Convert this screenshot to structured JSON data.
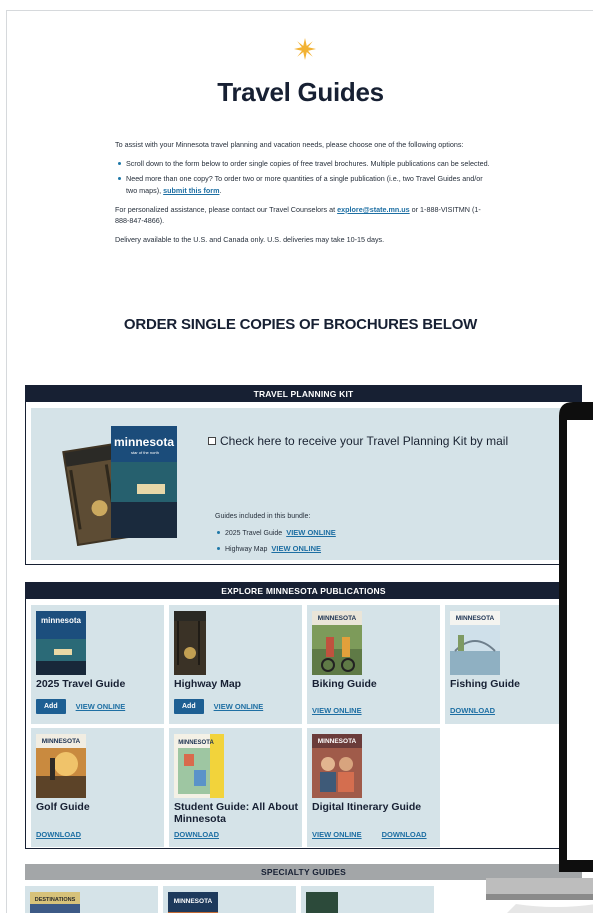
{
  "page": {
    "title": "Travel Guides",
    "intro_1": "To assist with your Minnesota travel planning and vacation needs, please choose one of the following options:",
    "bullet_1": "Scroll down to the form below to order single copies of free travel brochures. Multiple publications can be selected.",
    "bullet_2_text": "Need more than one copy? To order two or more quantities of a single publication (i.e., two Travel Guides and/or two maps),",
    "bullet_2_link": "submit this form",
    "contact_pre": "For personalized assistance, please contact our Travel Counselors at",
    "contact_email": "explore@state.mn.us",
    "contact_post": "or 1-888-VISITMN (1-888-847-4866).",
    "delivery": "Delivery available to the U.S. and Canada only. U.S. deliveries may take 10-15 days.",
    "order_heading": "ORDER SINGLE COPIES OF BROCHURES BELOW"
  },
  "kit": {
    "header": "TRAVEL PLANNING KIT",
    "checkbox_label": "Check here to receive your Travel Planning Kit by mail",
    "included_label": "Guides included in this bundle:",
    "items": [
      {
        "name": "2025 Travel Guide",
        "link": "VIEW ONLINE"
      },
      {
        "name": "Highway Map",
        "link": "VIEW ONLINE"
      }
    ],
    "cover_text": "minnesota",
    "cover_sub": "star of the north"
  },
  "publications": {
    "header": "EXPLORE MINNESOTA PUBLICATIONS",
    "cards": [
      {
        "name": "2025 Travel Guide",
        "add": "Add",
        "link1": "VIEW ONLINE",
        "cover": "minnesota"
      },
      {
        "name": "Highway Map",
        "add": "Add",
        "link1": "VIEW ONLINE",
        "cover": ""
      },
      {
        "name": "Biking Guide",
        "link1": "VIEW ONLINE",
        "cover": "MINNESOTA"
      },
      {
        "name": "Fishing Guide",
        "link1": "DOWNLOAD",
        "cover": "MINNESOTA"
      },
      {
        "name": "Golf Guide",
        "link1": "DOWNLOAD",
        "cover": "MINNESOTA"
      },
      {
        "name": "Student Guide: All About Minnesota",
        "link1": "DOWNLOAD",
        "cover": "MINNESOTA"
      },
      {
        "name": "Digital Itinerary Guide",
        "link1": "VIEW ONLINE",
        "link2": "DOWNLOAD",
        "cover": "MINNESOTA"
      }
    ]
  },
  "specialty": {
    "header": "SPECIALTY GUIDES",
    "covers": [
      "DESTINATIONS",
      "MINNESOTA",
      ""
    ]
  },
  "colors": {
    "navy": "#172033",
    "card_bg": "#d5e3e8",
    "link": "#1e6fa3",
    "add_button": "#1d5f93",
    "sun": "#f2b233",
    "specialty_header": "#a3a6a8"
  }
}
